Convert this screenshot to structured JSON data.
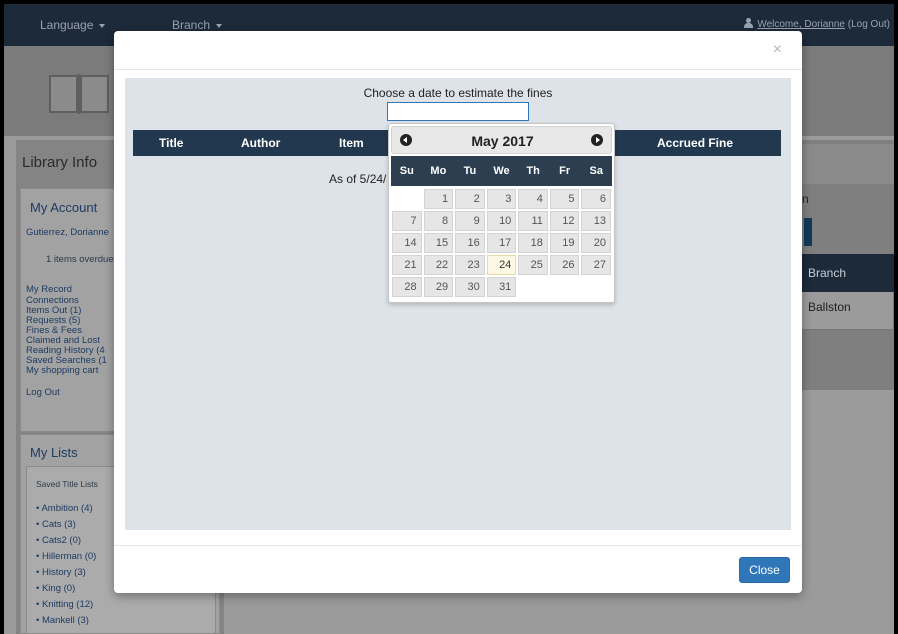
{
  "topnav": {
    "language": "Language",
    "branch": "Branch",
    "welcome": "Welcome, Dorianne",
    "logout": "(Log Out)"
  },
  "sidebar": {
    "title": "Library Info",
    "my_account": "My Account",
    "patron_name": "Gutierrez, Dorianne",
    "overdue": "1 items overdue",
    "links": [
      "My Record",
      "Connections",
      "Items Out (1)",
      "Requests (5)",
      "Fines & Fees",
      "Claimed and Lost",
      "Reading History (4",
      "Saved Searches (1",
      "My shopping cart"
    ],
    "logout": "Log Out",
    "my_lists": "My Lists",
    "saved_title_lists": "Saved Title Lists",
    "lists": [
      "Ambition (4)",
      "Cats (3)",
      "Cats2 (0)",
      "Hillerman (0)",
      "History (3)",
      "King (0)",
      "Knitting (12)",
      "Mankell (3)"
    ]
  },
  "right_panel": {
    "partial_text": "n",
    "header": "Branch",
    "cell": "Ballston"
  },
  "modal": {
    "close_x": "×",
    "prompt": "Choose a date to estimate the fines",
    "date_value": "",
    "columns": [
      "Title",
      "Author",
      "Item",
      "Accrued Fine"
    ],
    "as_of": "As of 5/24/",
    "close_button": "Close"
  },
  "datepicker": {
    "title": "May 2017",
    "weekdays": [
      "Su",
      "Mo",
      "Tu",
      "We",
      "Th",
      "Fr",
      "Sa"
    ],
    "weeks": [
      [
        "",
        "1",
        "2",
        "3",
        "4",
        "5",
        "6"
      ],
      [
        "7",
        "8",
        "9",
        "10",
        "11",
        "12",
        "13"
      ],
      [
        "14",
        "15",
        "16",
        "17",
        "18",
        "19",
        "20"
      ],
      [
        "21",
        "22",
        "23",
        "24",
        "25",
        "26",
        "27"
      ],
      [
        "28",
        "29",
        "30",
        "31",
        "",
        "",
        ""
      ]
    ],
    "today": "24"
  },
  "colors": {
    "navbar": "#1c2a3a",
    "table_header": "#22384f",
    "primary_button": "#2f77b9",
    "today_highlight": "#fcf8e3"
  }
}
